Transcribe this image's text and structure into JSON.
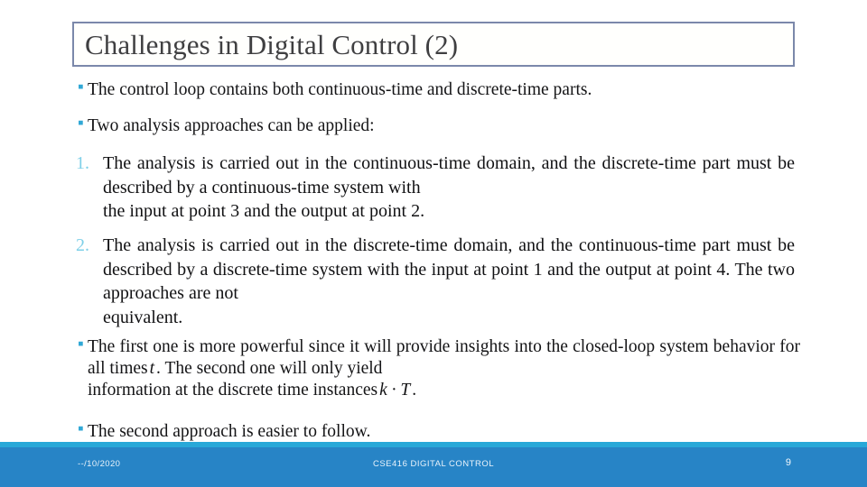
{
  "slide": {
    "title": "Challenges in Digital Control (2)",
    "bullet_glyph": "▪",
    "accent_color": "#28a8d8",
    "footer_color": "#2784c6",
    "title_border_color": "#7b88aa",
    "number_marker_color": "#7fd0e8"
  },
  "body": {
    "bullet_1": "The control loop contains both continuous-time and discrete-time parts.",
    "bullet_2": "Two analysis approaches can be applied:",
    "item_1": {
      "marker": "1.",
      "text_main": "The analysis is carried out in the continuous-time domain, and the discrete-time part must be described by a continuous-time system with",
      "text_last": "the input at point 3 and the output at point 2."
    },
    "item_2": {
      "marker": "2.",
      "text_main": "The analysis is carried out in the discrete-time domain, and the continuous-time part must be described by a discrete-time system with the input at point 1 and the output at point 4. The two approaches are not",
      "text_last": "equivalent."
    },
    "bullet_3": {
      "part_1": "The first one is more powerful since it will provide insights into the closed-loop system behavior for all times",
      "math_1": "t",
      "part_2": ". The second one will only yield",
      "text_last_pre": "information at the discrete time instances",
      "math_2": "k · T",
      "text_last_post": "."
    },
    "bullet_4": "The second approach is easier to follow."
  },
  "footer": {
    "date": "--/10/2020",
    "course": "CSE416 DIGITAL CONTROL",
    "page_number": "9"
  }
}
